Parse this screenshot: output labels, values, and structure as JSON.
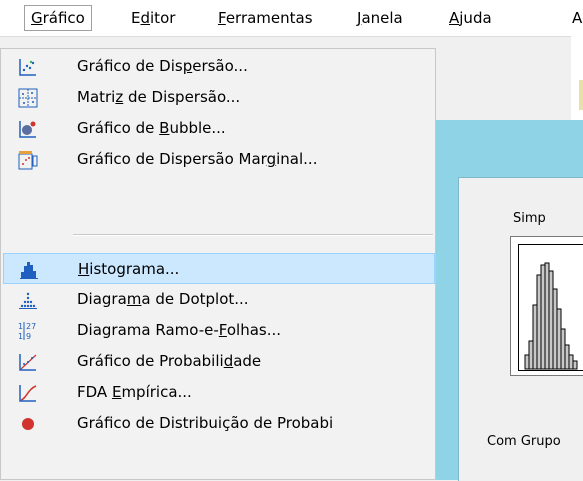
{
  "menubar": {
    "items": [
      {
        "pre": "",
        "acc": "G",
        "post": "ráfico"
      },
      {
        "pre": "E",
        "acc": "d",
        "post": "itor"
      },
      {
        "pre": "",
        "acc": "F",
        "post": "erramentas"
      },
      {
        "pre": "",
        "acc": "J",
        "post": "anela"
      },
      {
        "pre": "",
        "acc": "A",
        "post": "juda"
      },
      {
        "pre": "",
        "acc": "A",
        "post": ""
      }
    ]
  },
  "menu": {
    "items": [
      {
        "pre": "Gráfico de Dis",
        "acc": "p",
        "post": "ersão...",
        "icon": "scatterplot-icon"
      },
      {
        "pre": "Matri",
        "acc": "z",
        "post": " de Dispersão...",
        "icon": "matrix-plot-icon"
      },
      {
        "pre": "Gráfico de ",
        "acc": "B",
        "post": "ubble...",
        "icon": "bubble-plot-icon"
      },
      {
        "pre": "Gráfico de Dispersão Mar",
        "acc": "g",
        "post": "inal...",
        "icon": "marginal-plot-icon"
      },
      {
        "pre": "",
        "acc": "H",
        "post": "istograma...",
        "icon": "histogram-icon"
      },
      {
        "pre": "Diagra",
        "acc": "m",
        "post": "a de Dotplot...",
        "icon": "dotplot-icon"
      },
      {
        "pre": "Diagrama Ramo-e-",
        "acc": "F",
        "post": "olhas...",
        "icon": "stem-and-leaf-icon"
      },
      {
        "pre": "Gráfico de Probabili",
        "acc": "d",
        "post": "ade",
        "icon": "probability-plot-icon"
      },
      {
        "pre": "FDA ",
        "acc": "E",
        "post": "mpírica...",
        "icon": "empirical-cdf-icon"
      },
      {
        "pre": "Gráfico de Distribuição de Probabi",
        "acc": "",
        "post": "",
        "icon": "distribution-plot-icon"
      }
    ]
  },
  "dialog": {
    "label_simple": "Simp",
    "label_with_groups": "Com Grupo"
  },
  "colors": {
    "highlight": "#cce8ff",
    "dialog_frame": "#8fd3e6",
    "icon_blue": "#1f5fbf"
  }
}
